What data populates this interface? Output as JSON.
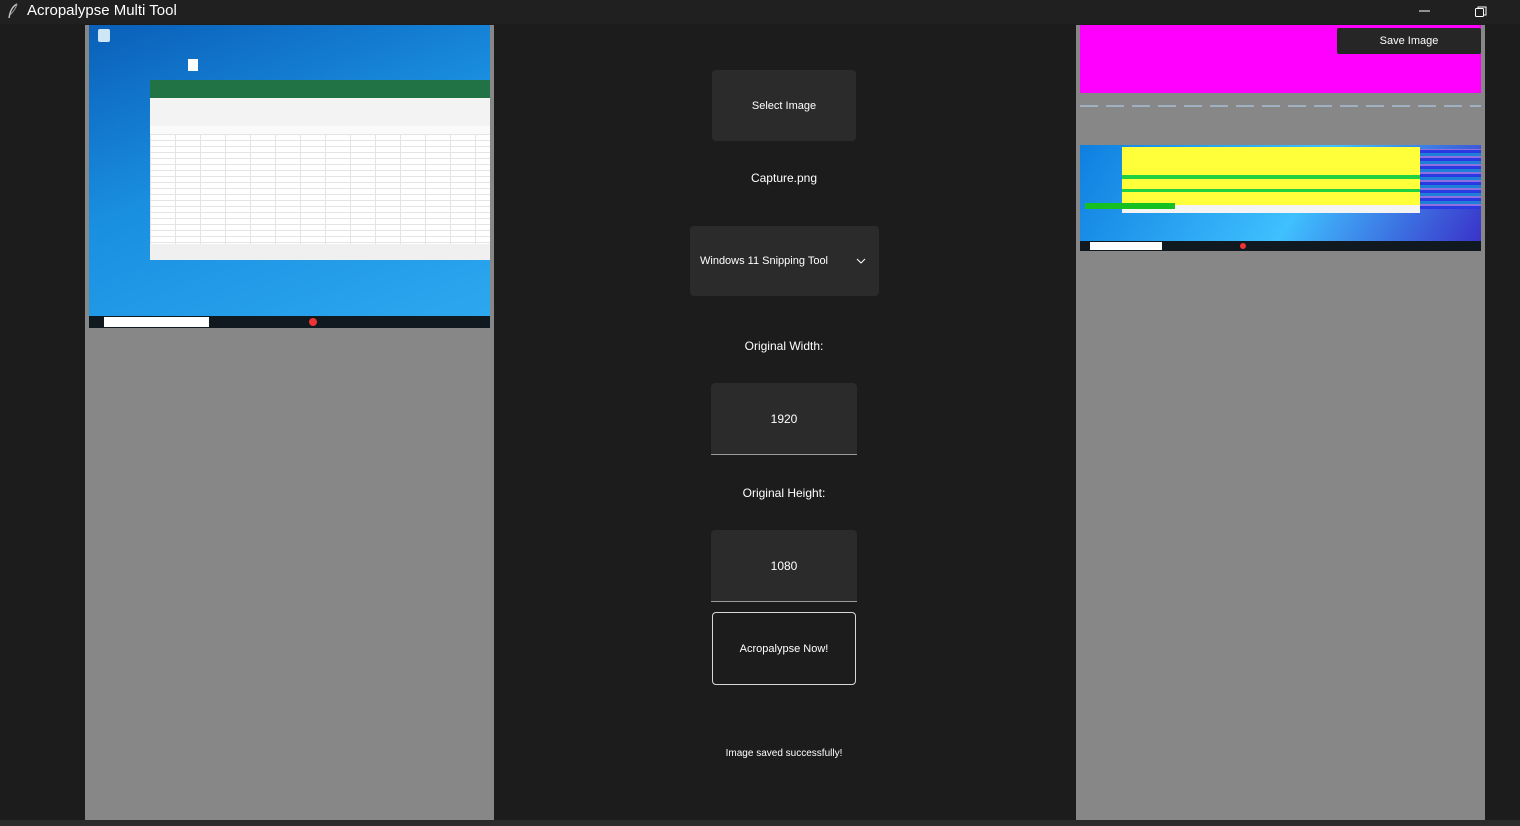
{
  "window": {
    "title": "Acropalypse Multi Tool"
  },
  "controls": {
    "select_image_label": "Select Image",
    "selected_file": "Capture.png",
    "tool_selected": "Windows 11 Snipping Tool",
    "original_width_label": "Original Width:",
    "original_width_value": "1920",
    "original_height_label": "Original Height:",
    "original_height_value": "1080",
    "run_label": "Acropalypse Now!",
    "status_text": "Image saved successfully!"
  },
  "right_panel": {
    "save_label": "Save Image"
  },
  "colors": {
    "background": "#1c1c1c",
    "panel_gray": "#878787",
    "button_bg": "#2b2b2b",
    "magenta": "#ff00ff",
    "desktop_blue": "#1a8fe0",
    "excel_green": "#217346"
  },
  "icons": {
    "app": "feather-icon",
    "minimize": "minimize-icon",
    "restore": "restore-icon",
    "dropdown": "chevron-down-icon"
  }
}
